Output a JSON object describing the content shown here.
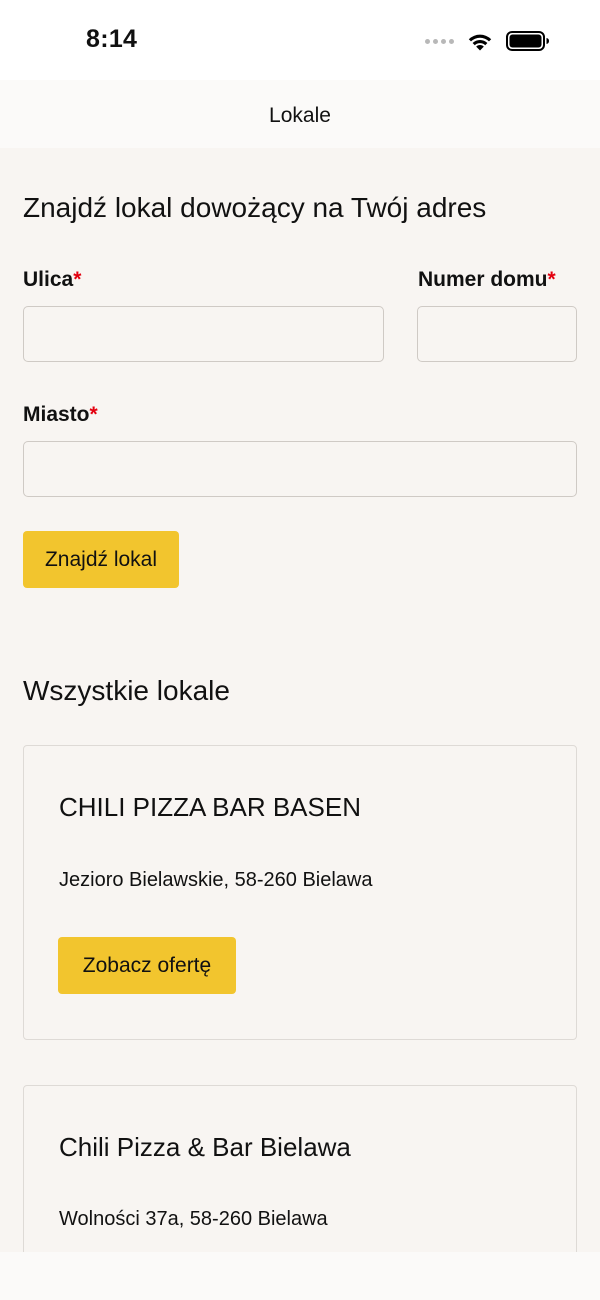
{
  "status_bar": {
    "time": "8:14",
    "icons": [
      "signal-dots-icon",
      "wifi-icon",
      "battery-icon"
    ]
  },
  "nav": {
    "title": "Lokale"
  },
  "search": {
    "heading": "Znajdź lokal dowożący na Twój adres",
    "street_label": "Ulica",
    "house_number_label": "Numer domu",
    "city_label": "Miasto",
    "required_mark": "*",
    "street_value": "",
    "house_number_value": "",
    "city_value": "",
    "submit_label": "Znajdź lokal"
  },
  "restaurants": {
    "heading": "Wszystkie lokale",
    "items": [
      {
        "name": "CHILI PIZZA BAR BASEN",
        "address": "Jezioro Bielawskie, 58-260 Bielawa",
        "button_label": "Zobacz ofertę"
      },
      {
        "name": "Chili Pizza & Bar Bielawa",
        "address": "Wolności 37a, 58-260 Bielawa"
      }
    ]
  },
  "colors": {
    "accent": "#f2c52e",
    "required": "#e3000f",
    "background": "#f8f5f2"
  }
}
